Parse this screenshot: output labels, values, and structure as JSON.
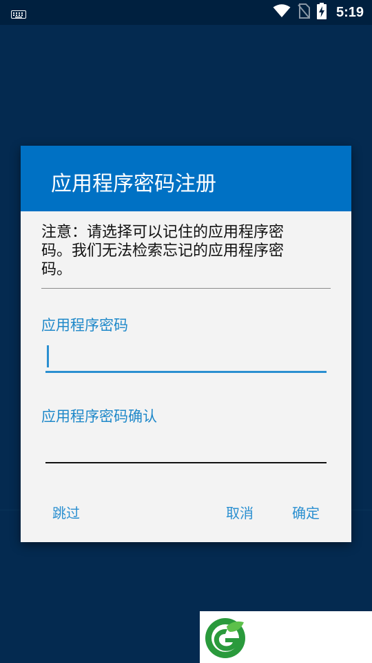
{
  "status_bar": {
    "time": "5:19",
    "icons": [
      "keyboard-icon",
      "wifi-icon",
      "no-sim-icon",
      "battery-charging-icon"
    ]
  },
  "dialog": {
    "title": "应用程序密码注册",
    "notice_lines": [
      "注意：请选择可以记住的应用程序密",
      "码。我们无法检索忘记的应用程序密",
      "码。"
    ],
    "password_label": "应用程序密码",
    "password_value": "",
    "confirm_label": "应用程序密码确认",
    "confirm_value": "",
    "buttons": {
      "skip": "跳过",
      "cancel": "取消",
      "ok": "确定"
    }
  },
  "colors": {
    "background": "#042a50",
    "status_bar": "#00203f",
    "header": "#0071c4",
    "accent": "#2a8fd0",
    "dialog_body": "#f3f3f3"
  },
  "watermark": {
    "icon": "leaf-logo-icon"
  }
}
